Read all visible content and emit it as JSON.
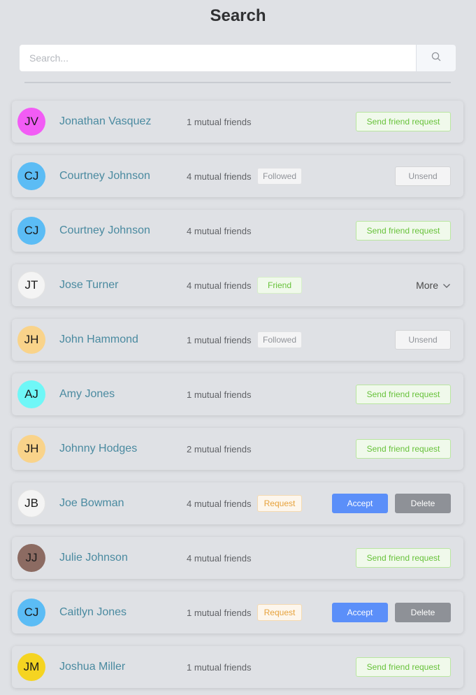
{
  "page": {
    "title": "Search"
  },
  "search": {
    "placeholder": "Search...",
    "value": ""
  },
  "labels": {
    "send_request": "Send friend request",
    "unsend": "Unsend",
    "accept": "Accept",
    "delete": "Delete",
    "more": "More"
  },
  "colors": {
    "background": "#dfe1e5",
    "name_text": "#4a8aa0",
    "accept_blue": "#5b8ff9",
    "delete_gray": "#8e9197",
    "success_green": "#67c23a",
    "warning_orange": "#e6a23c"
  },
  "people": [
    {
      "initials": "JV",
      "avatar_color": "#f25cf5",
      "name": "Jonathan Vasquez",
      "mutual": "1 mutual friends",
      "badge": null,
      "badge_type": null,
      "action": "send"
    },
    {
      "initials": "CJ",
      "avatar_color": "#5bbcf5",
      "name": "Courtney Johnson",
      "mutual": "4 mutual friends",
      "badge": "Followed",
      "badge_type": "followed",
      "action": "unsend"
    },
    {
      "initials": "CJ",
      "avatar_color": "#5bbcf5",
      "name": "Courtney Johnson",
      "mutual": "4 mutual friends",
      "badge": null,
      "badge_type": null,
      "action": "send"
    },
    {
      "initials": "JT",
      "avatar_color": "#f7f7f7",
      "name": "Jose Turner",
      "mutual": "4 mutual friends",
      "badge": "Friend",
      "badge_type": "friend",
      "action": "more"
    },
    {
      "initials": "JH",
      "avatar_color": "#f9d38a",
      "name": "John Hammond",
      "mutual": "1 mutual friends",
      "badge": "Followed",
      "badge_type": "followed",
      "action": "unsend"
    },
    {
      "initials": "AJ",
      "avatar_color": "#6ff7f7",
      "name": "Amy Jones",
      "mutual": "1 mutual friends",
      "badge": null,
      "badge_type": null,
      "action": "send"
    },
    {
      "initials": "JH",
      "avatar_color": "#f9d38a",
      "name": "Johnny Hodges",
      "mutual": "2 mutual friends",
      "badge": null,
      "badge_type": null,
      "action": "send"
    },
    {
      "initials": "JB",
      "avatar_color": "#e2e2e2",
      "name": "Joe Bowman",
      "mutual": "4 mutual friends",
      "badge": "Request",
      "badge_type": "request",
      "action": "accept-delete"
    },
    {
      "initials": "JJ",
      "avatar_color": "#8c6b62",
      "name": "Julie Johnson",
      "mutual": "4 mutual friends",
      "badge": null,
      "badge_type": null,
      "action": "send"
    },
    {
      "initials": "CJ",
      "avatar_color": "#5bbcf5",
      "name": "Caitlyn Jones",
      "mutual": "1 mutual friends",
      "badge": "Request",
      "badge_type": "request",
      "action": "accept-delete"
    },
    {
      "initials": "JM",
      "avatar_color": "#f5d421",
      "name": "Joshua Miller",
      "mutual": "1 mutual friends",
      "badge": null,
      "badge_type": null,
      "action": "send"
    }
  ]
}
